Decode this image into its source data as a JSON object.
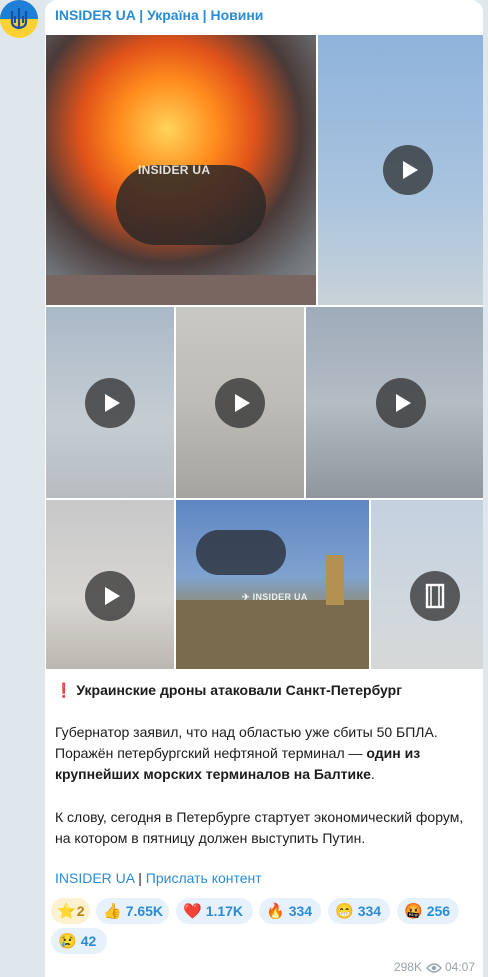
{
  "channel": {
    "name": "INSIDER UA | Україна | Новини"
  },
  "media": {
    "watermark": "INSIDER UA",
    "watermark_small": "✈ INSIDER UA",
    "tiles": [
      {
        "kind": "photo",
        "label": "explosion"
      },
      {
        "kind": "video",
        "icon": "play-icon"
      },
      {
        "kind": "video",
        "icon": "play-icon"
      },
      {
        "kind": "video",
        "icon": "play-icon"
      },
      {
        "kind": "video",
        "icon": "play-icon"
      },
      {
        "kind": "video",
        "icon": "play-icon"
      },
      {
        "kind": "photo",
        "label": "city-smoke"
      },
      {
        "kind": "video",
        "icon": "film-icon"
      }
    ]
  },
  "post": {
    "alert_icon": "❗",
    "headline": "Украинские дроны атаковали Санкт-Петербург",
    "p1_a": "Губернатор заявил, что над областью уже сбиты 50 БПЛА. Поражён петербургский нефтяной терминал — ",
    "p1_bold": "один из крупнейших морских терминалов на Балтике",
    "p1_end": ".",
    "p2": "К слову, сегодня в Петербурге стартует экономический форум, на котором в пятницу должен выступить Путин.",
    "link1": "INSIDER UA",
    "sep": " | ",
    "link2": "Прислать контент"
  },
  "reactions": [
    {
      "emoji": "⭐",
      "count": "2"
    },
    {
      "emoji": "👍",
      "count": "7.65K"
    },
    {
      "emoji": "❤️",
      "count": "1.17K"
    },
    {
      "emoji": "🔥",
      "count": "334"
    },
    {
      "emoji": "😁",
      "count": "334"
    },
    {
      "emoji": "🤬",
      "count": "256"
    },
    {
      "emoji": "😢",
      "count": "42"
    }
  ],
  "footer": {
    "views": "298K",
    "time": "04:07"
  },
  "colors": {
    "link": "#2b8cd6",
    "reaction_bg": "#e7f1fb",
    "background": "#dfe7ec"
  }
}
